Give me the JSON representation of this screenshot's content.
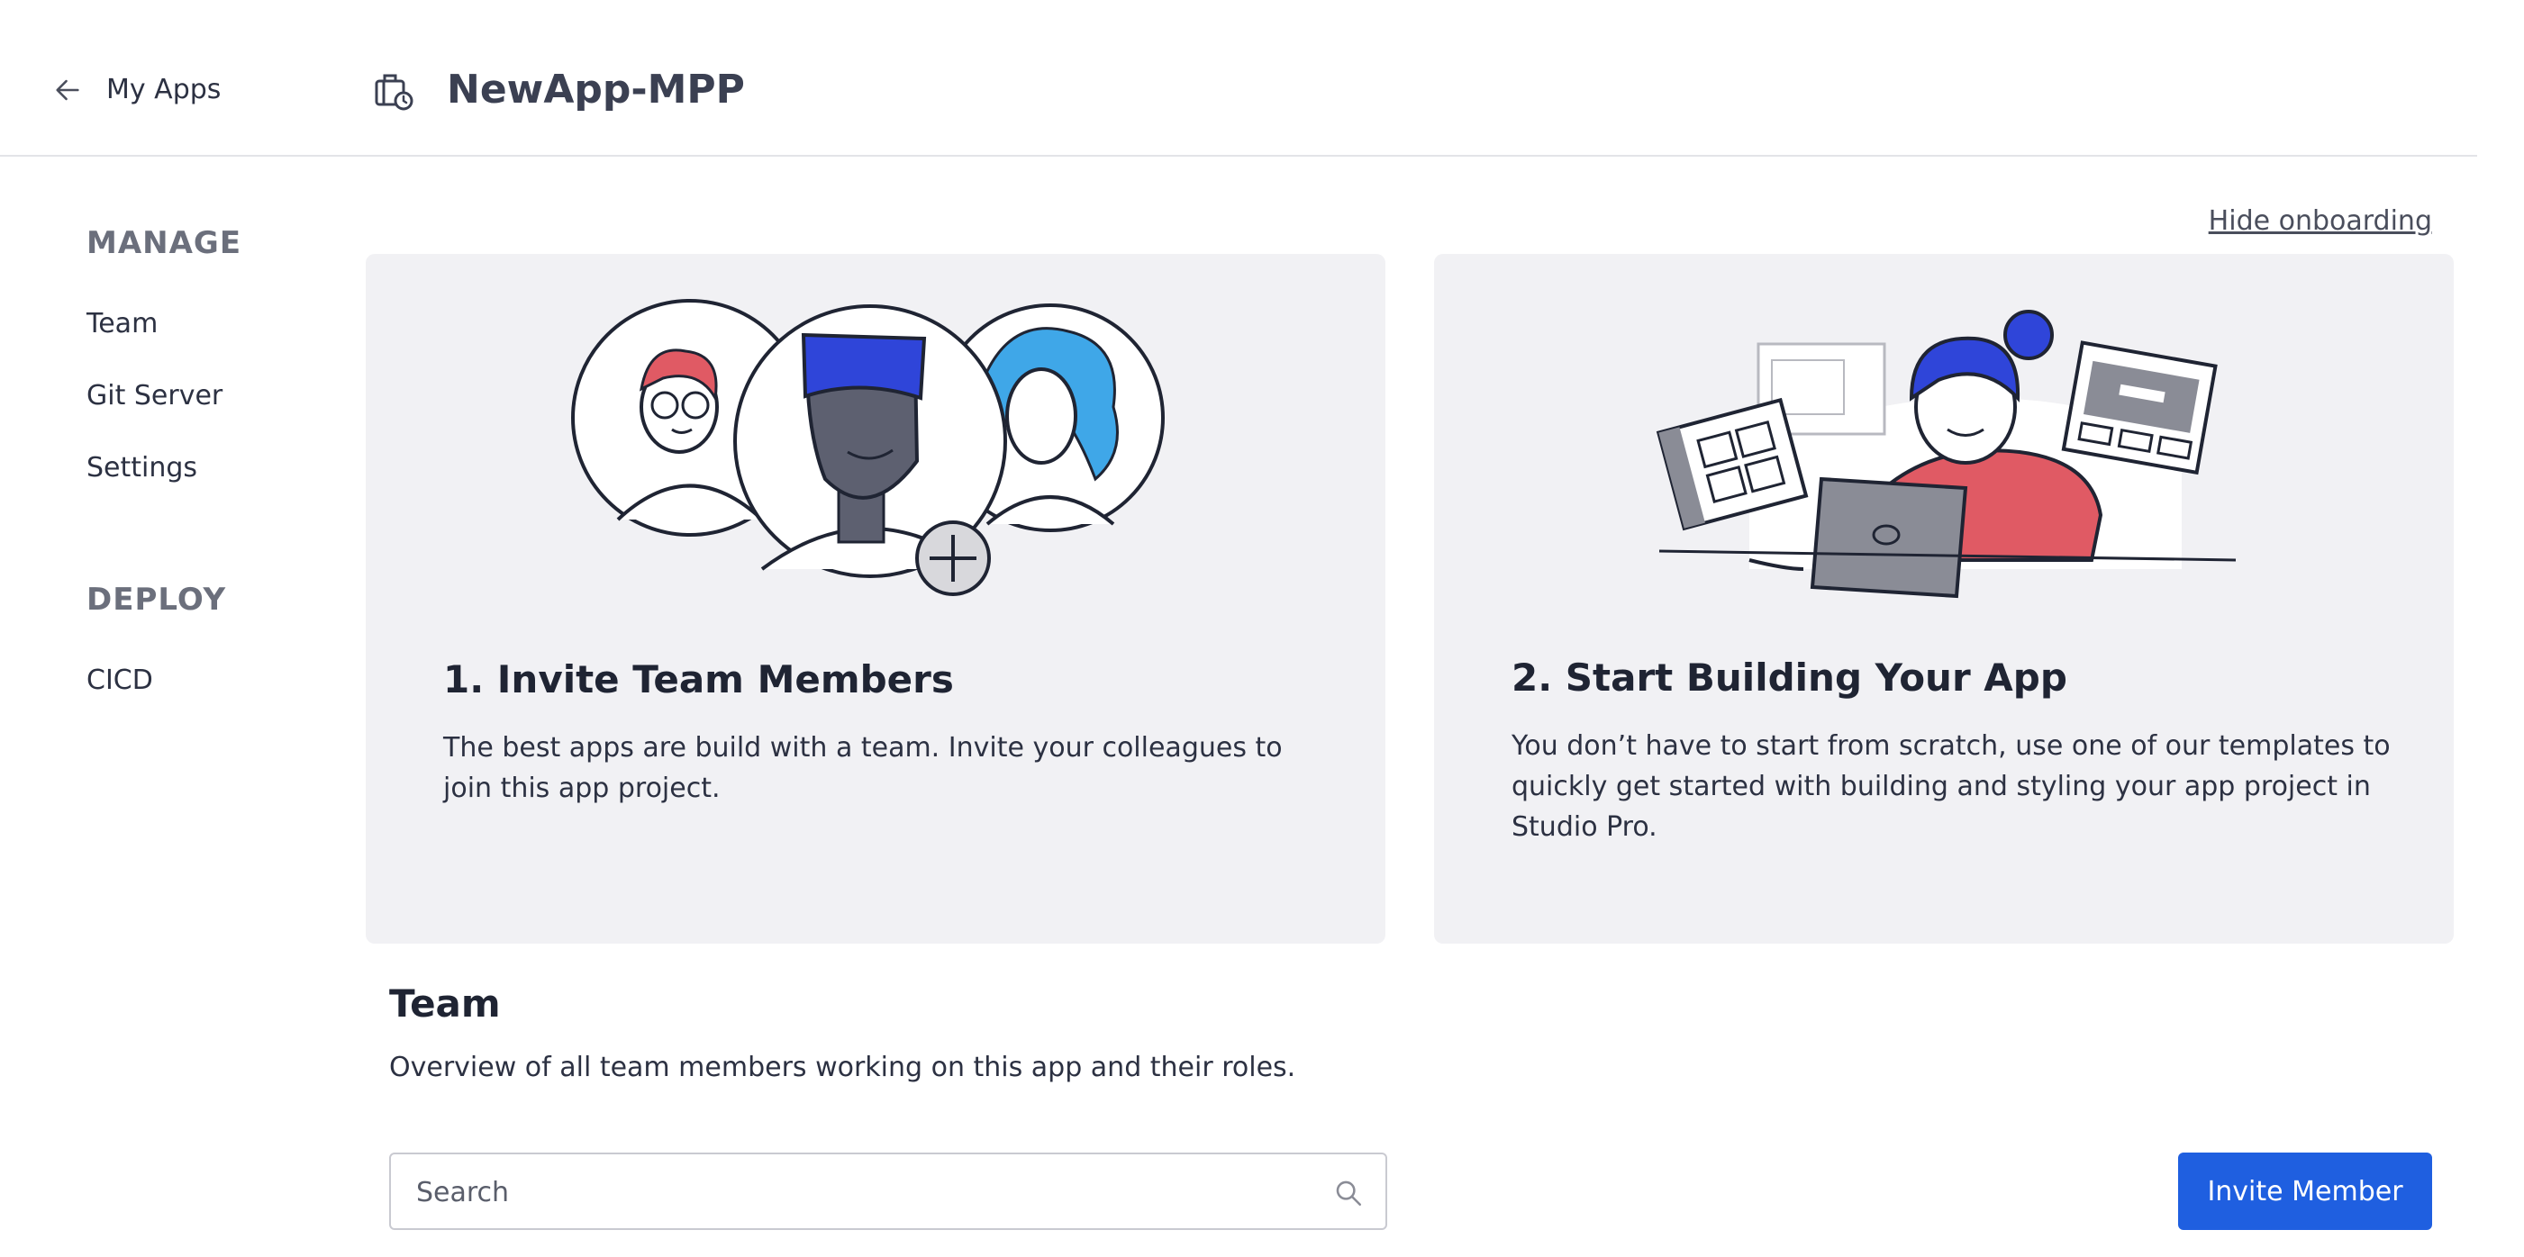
{
  "header": {
    "back_label": "My Apps",
    "app_title": "NewApp-MPP"
  },
  "sidebar": {
    "sections": [
      {
        "heading": "MANAGE",
        "items": [
          "Team",
          "Git Server",
          "Settings"
        ]
      },
      {
        "heading": "DEPLOY",
        "items": [
          "CICD"
        ]
      }
    ]
  },
  "onboarding": {
    "hide_label": "Hide onboarding",
    "cards": [
      {
        "title": "1. Invite Team Members",
        "text": "The best apps are build with a team. Invite your colleagues to join this app project."
      },
      {
        "title": "2. Start Building Your App",
        "text": "You don’t have to start from scratch, use one of our templates to quickly get started with building and styling your app project in Studio Pro."
      }
    ]
  },
  "team": {
    "title": "Team",
    "subtitle": "Overview of all team members working on this app and their roles.",
    "search_placeholder": "Search",
    "invite_label": "Invite Member"
  },
  "colors": {
    "accent": "#1f5fe0",
    "card_bg": "#f1f1f4",
    "illustration_blue": "#2f45d9",
    "illustration_red": "#e05a64"
  },
  "icons": [
    "arrow-left-icon",
    "app-briefcase-icon",
    "search-icon",
    "plus-circle-icon"
  ]
}
